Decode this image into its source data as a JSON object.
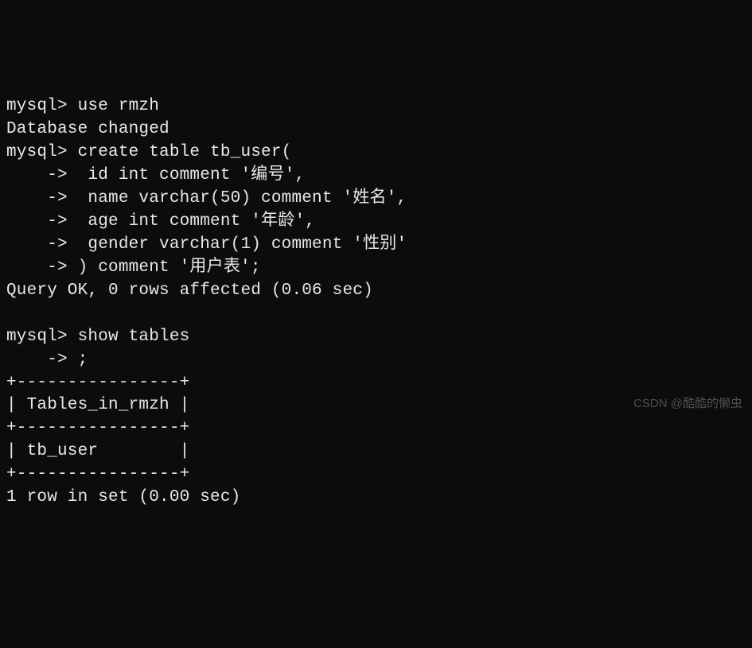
{
  "terminal": {
    "lines": [
      "mysql> use rmzh",
      "Database changed",
      "mysql> create table tb_user(",
      "    ->  id int comment '编号',",
      "    ->  name varchar(50) comment '姓名',",
      "    ->  age int comment '年龄',",
      "    ->  gender varchar(1) comment '性别'",
      "    -> ) comment '用户表';",
      "Query OK, 0 rows affected (0.06 sec)",
      "",
      "mysql> show tables",
      "    -> ;",
      "+----------------+",
      "| Tables_in_rmzh |",
      "+----------------+",
      "| tb_user        |",
      "+----------------+",
      "1 row in set (0.00 sec)"
    ]
  },
  "watermark": "CSDN @酷酷的懒虫"
}
